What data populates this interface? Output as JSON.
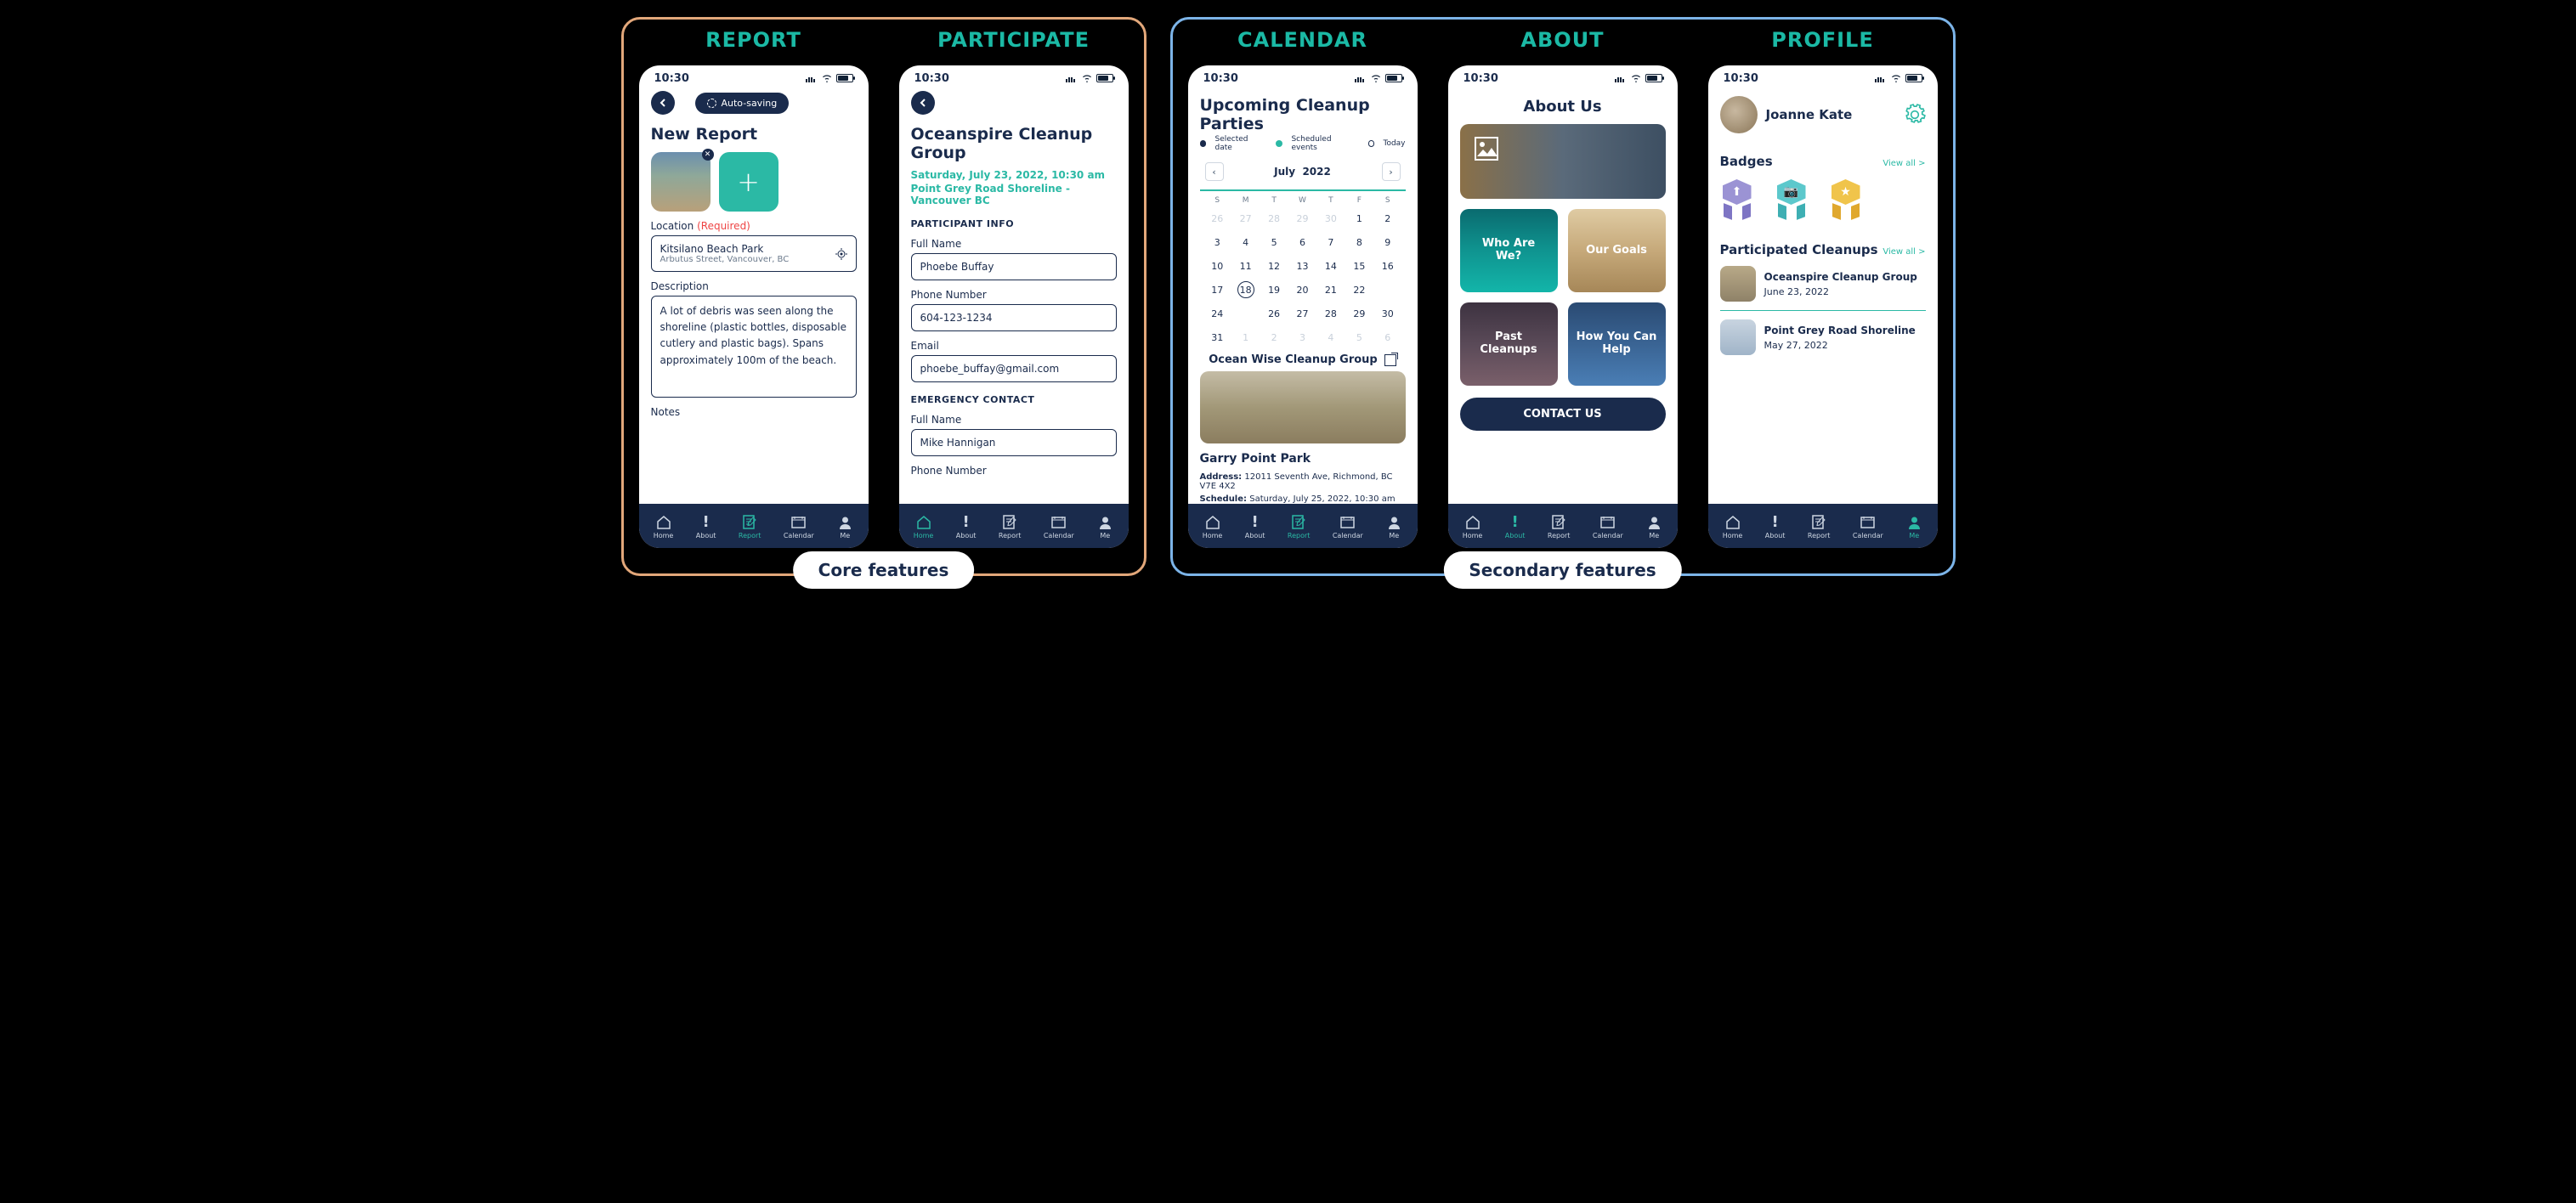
{
  "columns": {
    "report": "REPORT",
    "participate": "PARTICIPATE",
    "calendar": "CALENDAR",
    "about": "ABOUT",
    "profile": "PROFILE"
  },
  "groups": {
    "core": "Core features",
    "secondary": "Secondary features"
  },
  "status_time": "10:30",
  "nav": {
    "home": "Home",
    "about": "About",
    "report": "Report",
    "calendar": "Calendar",
    "me": "Me"
  },
  "report": {
    "auto_saving": "Auto-saving",
    "title": "New Report",
    "location_label": "Location",
    "required": "(Required)",
    "location_value": "Kitsilano Beach Park",
    "location_sub": "Arbutus Street, Vancouver, BC",
    "description_label": "Description",
    "description_value": "A lot of debris was seen along the shoreline (plastic bottles, disposable cutlery and plastic bags). Spans approximately 100m of the beach.",
    "notes_label": "Notes"
  },
  "participate": {
    "title": "Oceanspire Cleanup Group",
    "datetime": "Saturday, July 23, 2022, 10:30 am",
    "location": "Point Grey Road Shoreline - Vancouver BC",
    "participant_info": "PARTICIPANT INFO",
    "full_name_label": "Full Name",
    "full_name_value": "Phoebe Buffay",
    "phone_label": "Phone Number",
    "phone_value": "604-123-1234",
    "email_label": "Email",
    "email_value": "phoebe_buffay@gmail.com",
    "emergency": "EMERGENCY CONTACT",
    "ec_name_value": "Mike Hannigan"
  },
  "calendar": {
    "title": "Upcoming Cleanup Parties",
    "legend_selected": "Selected date",
    "legend_scheduled": "Scheduled events",
    "legend_today": "Today",
    "month": "July",
    "year": "2022",
    "dow": [
      "S",
      "M",
      "T",
      "W",
      "T",
      "F",
      "S"
    ],
    "event_name": "Ocean Wise Cleanup Group",
    "event_title": "Garry Point Park",
    "address_label": "Address:",
    "address_value": "12011 Seventh Ave, Richmond, BC V7E 4X2",
    "schedule_label": "Schedule:",
    "schedule_value": "Saturday, July 25, 2022, 10:30 am"
  },
  "about": {
    "title": "About Us",
    "card1": "Who Are We?",
    "card2": "Our Goals",
    "card3": "Past Cleanups",
    "card4": "How You Can Help",
    "contact": "CONTACT US"
  },
  "profile": {
    "name": "Joanne Kate",
    "badges_label": "Badges",
    "view_all": "View all >",
    "participated": "Participated Cleanups",
    "item1_title": "Oceanspire Cleanup Group",
    "item1_date": "June 23, 2022",
    "item2_title": "Point Grey Road Shoreline",
    "item2_date": "May 27, 2022"
  }
}
